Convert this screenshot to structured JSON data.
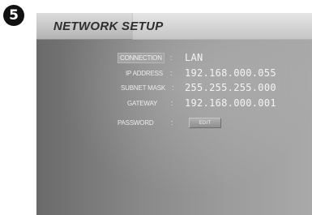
{
  "step_number": "5",
  "title": "NETWORK SETUP",
  "fields": [
    {
      "label": "CONNECTION",
      "value": "LAN"
    },
    {
      "label": "IP ADDRESS",
      "value": "192.168.000.055"
    },
    {
      "label": "SUBNET MASK",
      "value": "255.255.255.000"
    },
    {
      "label": "GATEWAY",
      "value": "192.168.000.001"
    }
  ],
  "password": {
    "label": "PASSWORD",
    "button_label": "EDIT"
  },
  "separator": ":"
}
